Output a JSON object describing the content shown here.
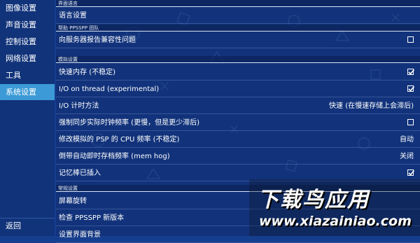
{
  "colors": {
    "background": "#163e8e",
    "sidebar": "#11337a",
    "active": "#3c9ad6",
    "text": "#ffffff"
  },
  "sidebar": {
    "items": [
      {
        "label": "图像设置"
      },
      {
        "label": "声音设置"
      },
      {
        "label": "控制设置"
      },
      {
        "label": "网络设置"
      },
      {
        "label": "工具"
      },
      {
        "label": "系统设置",
        "active": true
      }
    ],
    "back_label": "返回"
  },
  "sections": [
    {
      "header": "界面语言"
    },
    {
      "header": "帮助 PPSSPP 团队"
    },
    {
      "header": "模拟设置"
    },
    {
      "header": "常规设置"
    }
  ],
  "rows": [
    {
      "label": "语言设置"
    },
    {
      "label": "向服务器报告兼容性问题",
      "checked": false
    },
    {
      "label": "快速内存 (不稳定)",
      "checked": true
    },
    {
      "label": "I/O on thread (experimental)",
      "checked": true
    },
    {
      "label": "I/O 计时方法",
      "value": "快速 (在慢速存储上会滞后)"
    },
    {
      "label": "强制同步实际时钟频率 (更慢，但是更少滞后)",
      "checked": false
    },
    {
      "label": "修改模拟的 PSP 的 CPU 频率 (不稳定)",
      "value": "自动"
    },
    {
      "label": "倒带自动即时存档频率 (mem hog)",
      "value": "关闭"
    },
    {
      "label": "记忆棒已插入",
      "checked": true
    },
    {
      "label": "屏幕旋转"
    },
    {
      "label": "检查 PPSSPP 新版本"
    },
    {
      "label": "设置界面背景"
    }
  ],
  "watermark": {
    "title": "下载鸟应用",
    "url": "www.xiazainiao.com"
  }
}
